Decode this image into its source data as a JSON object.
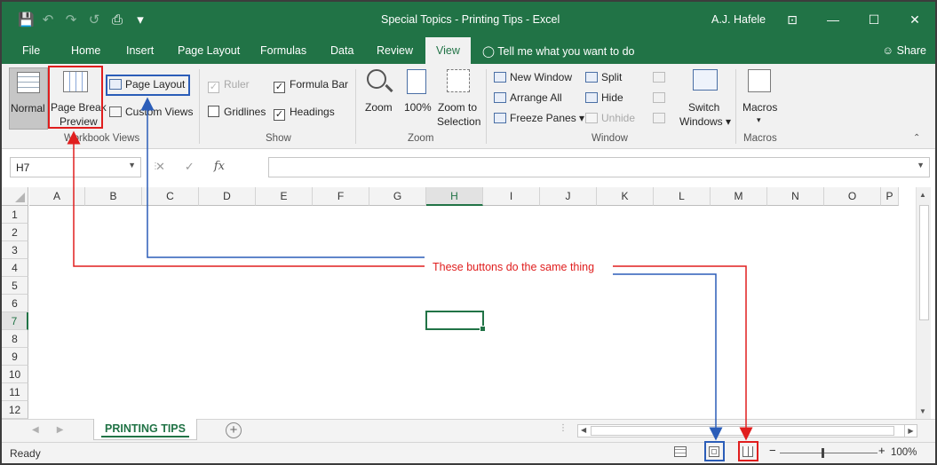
{
  "window": {
    "title": "Special Topics - Printing Tips  -  Excel",
    "user": "A.J. Hafele",
    "controls": [
      "⊡",
      "—",
      "☐",
      "✕"
    ]
  },
  "qat_icons": [
    "save-icon",
    "undo-icon",
    "redo-icon",
    "touch-mode-icon",
    "print-preview-icon",
    "customize-icon"
  ],
  "tabs": [
    "File",
    "Home",
    "Insert",
    "Page Layout",
    "Formulas",
    "Data",
    "Review",
    "View"
  ],
  "active_tab": "View",
  "tell_me": "Tell me what you want to do",
  "share": "Share",
  "ribbon": {
    "workbook_views": {
      "label": "Workbook Views",
      "normal": "Normal",
      "page_break_1": "Page Break",
      "page_break_2": "Preview",
      "page_layout": "Page Layout",
      "custom_views": "Custom Views"
    },
    "show": {
      "label": "Show",
      "ruler": "Ruler",
      "formula_bar": "Formula Bar",
      "gridlines": "Gridlines",
      "headings": "Headings"
    },
    "zoom": {
      "label": "Zoom",
      "zoom": "Zoom",
      "hundred": "100%",
      "zoom_sel_1": "Zoom to",
      "zoom_sel_2": "Selection"
    },
    "window": {
      "label": "Window",
      "new_window": "New Window",
      "arrange_all": "Arrange All",
      "freeze_panes": "Freeze Panes ▾",
      "split": "Split",
      "hide": "Hide",
      "unhide": "Unhide",
      "switch_1": "Switch",
      "switch_2": "Windows ▾"
    },
    "macros": {
      "label": "Macros",
      "button": "Macros",
      "arrow": "▾"
    }
  },
  "formula_bar": {
    "name_box": "H7",
    "cancel": "✕",
    "enter": "✓",
    "fx": "fx",
    "value": ""
  },
  "grid": {
    "columns": [
      "A",
      "B",
      "C",
      "D",
      "E",
      "F",
      "G",
      "H",
      "I",
      "J",
      "K",
      "L",
      "M",
      "N",
      "O",
      "P"
    ],
    "rows": [
      "1",
      "2",
      "3",
      "4",
      "5",
      "6",
      "7",
      "8",
      "9",
      "10",
      "11",
      "12"
    ],
    "selected_column": "H",
    "selected_row": "7"
  },
  "sheet": {
    "tab": "PRINTING TIPS",
    "add": "+"
  },
  "status": {
    "ready": "Ready",
    "zoom_minus": "−",
    "zoom_plus": "+",
    "zoom_pct": "100%"
  },
  "annotation": {
    "text": "These buttons do the same thing",
    "colors": {
      "red": "#e01e1e",
      "blue": "#2b5db8"
    }
  }
}
